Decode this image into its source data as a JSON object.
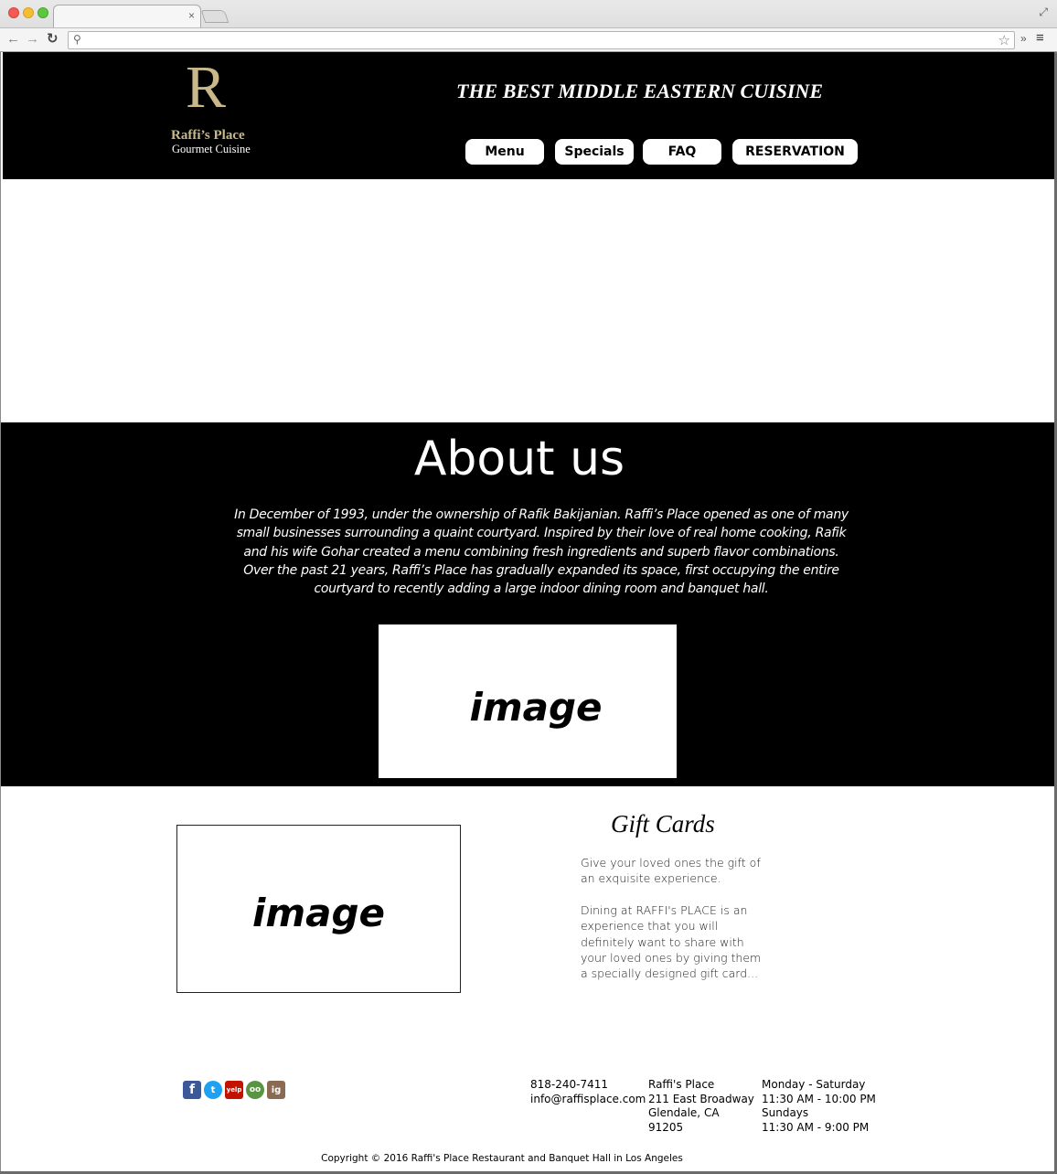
{
  "browser": {
    "tab_close": "×",
    "back_icon": "back-arrow-icon",
    "forward_icon": "forward-arrow-icon",
    "reload_icon": "reload-icon",
    "address_value": "",
    "search_icon": "search-icon",
    "bookmark_icon": "star-icon",
    "extensions_label": "»",
    "menu_icon": "hamburger-icon"
  },
  "header": {
    "logo_letter": "R",
    "logo_name": "Raffi’s Place",
    "logo_subtitle": "Gourmet Cuisine",
    "tagline": "THE BEST MIDDLE EASTERN CUISINE",
    "nav": {
      "menu": "Menu",
      "specials": "Specials",
      "faq": "FAQ",
      "reservation": "RESERVATION"
    }
  },
  "about": {
    "title": "About us",
    "text": "In December of 1993, under the ownership of Rafik Bakijanian. Raffi’s Place opened as one of many small businesses surrounding a quaint courtyard. Inspired by their love of real home cooking, Rafik and his wife Gohar created a menu combining fresh ingredients and superb flavor combinations. Over the past 21 years, Raffi’s Place has gradually expanded its space, first occupying the entire courtyard to recently adding a large indoor dining room and banquet hall.",
    "image_placeholder": "image"
  },
  "gift": {
    "image_placeholder": "image",
    "title": "Gift Cards",
    "paragraph1": "Give your loved ones the gift of an exquisite experience.",
    "paragraph2": "Dining at RAFFI's PLACE is an experience that you will definitely want to share with your loved ones by giving them a specially designed gift card..."
  },
  "footer": {
    "social": {
      "facebook": "f",
      "twitter": "t",
      "yelp": "yelp",
      "tripadvisor": "oo",
      "instagram": "ig"
    },
    "phone": "818-240-7411",
    "email": "info@raffisplace.com",
    "address_name": "Raffi's Place",
    "address_street": "211 East Broadway",
    "address_city": "Glendale, CA",
    "address_zip": "91205",
    "hours_days1": "Monday - Saturday",
    "hours_time1": "11:30 AM - 10:00 PM",
    "hours_days2": "Sundays",
    "hours_time2": "11:30 AM - 9:00 PM",
    "copyright": "Copyright © 2016 Raffi's Place Restaurant and Banquet Hall in Los Angeles"
  },
  "colors": {
    "header_bg": "#000000",
    "logo_gold": "#c9b98a",
    "facebook": "#3b5998",
    "twitter": "#1da1f2",
    "yelp": "#c41200",
    "tripadvisor": "#589442"
  }
}
